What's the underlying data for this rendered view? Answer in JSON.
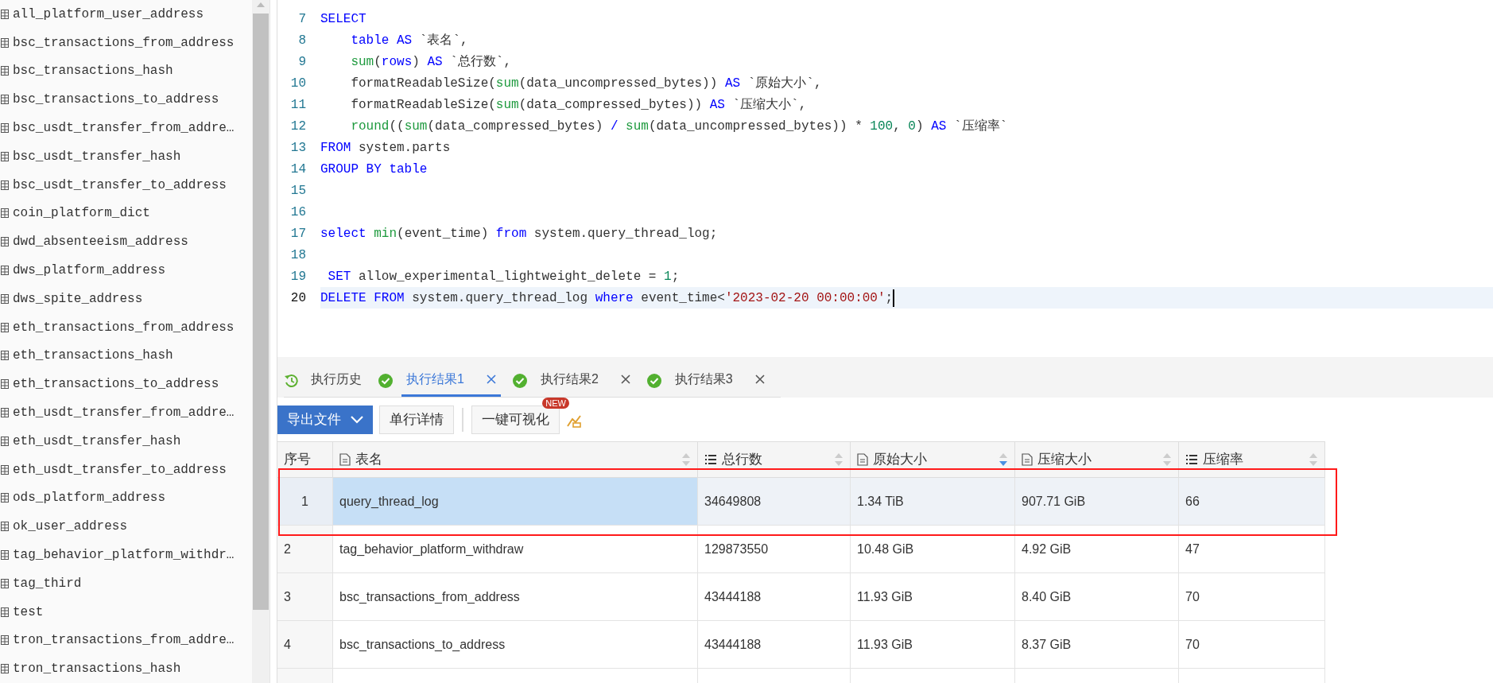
{
  "sidebar": {
    "items": [
      "all_platform_user_address",
      "bsc_transactions_from_address",
      "bsc_transactions_hash",
      "bsc_transactions_to_address",
      "bsc_usdt_transfer_from_addre…",
      "bsc_usdt_transfer_hash",
      "bsc_usdt_transfer_to_address",
      "coin_platform_dict",
      "dwd_absenteeism_address",
      "dws_platform_address",
      "dws_spite_address",
      "eth_transactions_from_address",
      "eth_transactions_hash",
      "eth_transactions_to_address",
      "eth_usdt_transfer_from_addre…",
      "eth_usdt_transfer_hash",
      "eth_usdt_transfer_to_address",
      "ods_platform_address",
      "ok_user_address",
      "tag_behavior_platform_withdr…",
      "tag_third",
      "test",
      "tron_transactions_from_addre…",
      "tron_transactions_hash"
    ]
  },
  "editor": {
    "lines": [
      {
        "number": "7",
        "current": false,
        "tokens": [
          {
            "kind": "keyword",
            "text": "SELECT"
          }
        ]
      },
      {
        "number": "8",
        "current": false,
        "tokens": [
          {
            "kind": "keyword",
            "text": "    table AS"
          },
          {
            "kind": "plain",
            "text": " `表名`,"
          }
        ]
      },
      {
        "number": "9",
        "current": false,
        "tokens": [
          {
            "kind": "function",
            "text": "    sum"
          },
          {
            "kind": "plain",
            "text": "("
          },
          {
            "kind": "keyword",
            "text": "rows"
          },
          {
            "kind": "plain",
            "text": ") "
          },
          {
            "kind": "keyword",
            "text": "AS"
          },
          {
            "kind": "plain",
            "text": " `总行数`,"
          }
        ]
      },
      {
        "number": "10",
        "current": false,
        "tokens": [
          {
            "kind": "plain",
            "text": "    formatReadableSize("
          },
          {
            "kind": "function",
            "text": "sum"
          },
          {
            "kind": "plain",
            "text": "(data_uncompressed_bytes)) "
          },
          {
            "kind": "keyword",
            "text": "AS"
          },
          {
            "kind": "plain",
            "text": " `原始大小`,"
          }
        ]
      },
      {
        "number": "11",
        "current": false,
        "tokens": [
          {
            "kind": "plain",
            "text": "    formatReadableSize("
          },
          {
            "kind": "function",
            "text": "sum"
          },
          {
            "kind": "plain",
            "text": "(data_compressed_bytes)) "
          },
          {
            "kind": "keyword",
            "text": "AS"
          },
          {
            "kind": "plain",
            "text": " `压缩大小`,"
          }
        ]
      },
      {
        "number": "12",
        "current": false,
        "tokens": [
          {
            "kind": "function",
            "text": "    round"
          },
          {
            "kind": "plain",
            "text": "(("
          },
          {
            "kind": "function",
            "text": "sum"
          },
          {
            "kind": "plain",
            "text": "(data_compressed_bytes) "
          },
          {
            "kind": "keyword",
            "text": "/ "
          },
          {
            "kind": "function",
            "text": "sum"
          },
          {
            "kind": "plain",
            "text": "(data_uncompressed_bytes)) * "
          },
          {
            "kind": "number",
            "text": "100"
          },
          {
            "kind": "plain",
            "text": ", "
          },
          {
            "kind": "number",
            "text": "0"
          },
          {
            "kind": "plain",
            "text": ") "
          },
          {
            "kind": "keyword",
            "text": "AS"
          },
          {
            "kind": "plain",
            "text": " `压缩率`"
          }
        ]
      },
      {
        "number": "13",
        "current": false,
        "tokens": [
          {
            "kind": "keyword",
            "text": "FROM"
          },
          {
            "kind": "plain",
            "text": " system.parts"
          }
        ]
      },
      {
        "number": "14",
        "current": false,
        "tokens": [
          {
            "kind": "keyword",
            "text": "GROUP BY table"
          }
        ]
      },
      {
        "number": "15",
        "current": false
      },
      {
        "number": "16",
        "current": false
      },
      {
        "number": "17",
        "current": false,
        "tokens": [
          {
            "kind": "keyword",
            "text": "select "
          },
          {
            "kind": "function",
            "text": "min"
          },
          {
            "kind": "plain",
            "text": "(event_time) "
          },
          {
            "kind": "keyword",
            "text": "from"
          },
          {
            "kind": "plain",
            "text": " system.query_thread_log;"
          }
        ]
      },
      {
        "number": "18",
        "current": false
      },
      {
        "number": "19",
        "current": false,
        "tokens": [
          {
            "kind": "keyword",
            "text": " SET"
          },
          {
            "kind": "plain",
            "text": " allow_experimental_lightweight_delete = "
          },
          {
            "kind": "number",
            "text": "1"
          },
          {
            "kind": "plain",
            "text": ";"
          }
        ]
      },
      {
        "number": "20",
        "current": true,
        "tokens": [
          {
            "kind": "keyword",
            "text": "DELETE FROM"
          },
          {
            "kind": "plain",
            "text": " system.query_thread_log "
          },
          {
            "kind": "keyword",
            "text": "where"
          },
          {
            "kind": "plain",
            "text": " event_time<"
          },
          {
            "kind": "string",
            "text": "'2023-02-20 00:00:00'"
          },
          {
            "kind": "plain",
            "text": ";"
          }
        ]
      }
    ]
  },
  "tabs": [
    {
      "label": "执行历史",
      "kind": "history",
      "selected": false
    },
    {
      "label": "执行结果1",
      "kind": "result",
      "selected": true
    },
    {
      "label": "执行结果2",
      "kind": "result",
      "selected": false
    },
    {
      "label": "执行结果3",
      "kind": "result",
      "selected": false
    }
  ],
  "toolbar": [
    {
      "label": "导出文件",
      "kind": "dropdown"
    },
    {
      "label": "单行详情",
      "kind": "plain"
    },
    {
      "label": "一键可视化",
      "kind": "plain",
      "badge": "NEW"
    }
  ],
  "table": {
    "columns": [
      {
        "label": "序号",
        "kind": "index"
      },
      {
        "label": "表名",
        "kind": "text",
        "sorted_descending": false
      },
      {
        "label": "总行数",
        "kind": "number",
        "sorted_descending": false
      },
      {
        "label": "原始大小",
        "kind": "text",
        "sorted_descending": true
      },
      {
        "label": "压缩大小",
        "kind": "text",
        "sorted_descending": false
      },
      {
        "label": "压缩率",
        "kind": "number",
        "sorted_descending": false
      }
    ],
    "rows": [
      {
        "selected": true,
        "cells": [
          {
            "text": "1",
            "selected": false
          },
          {
            "text": "query_thread_log",
            "selected": true
          },
          {
            "text": "34649808",
            "selected": false
          },
          {
            "text": "1.34 TiB",
            "selected": false
          },
          {
            "text": "907.71 GiB",
            "selected": false
          },
          {
            "text": "66",
            "selected": false
          }
        ]
      },
      {
        "selected": false,
        "cells": [
          {
            "text": "2",
            "selected": false
          },
          {
            "text": "tag_behavior_platform_withdraw",
            "selected": false
          },
          {
            "text": "129873550",
            "selected": false
          },
          {
            "text": "10.48 GiB",
            "selected": false
          },
          {
            "text": "4.92 GiB",
            "selected": false
          },
          {
            "text": "47",
            "selected": false
          }
        ]
      },
      {
        "selected": false,
        "cells": [
          {
            "text": "3",
            "selected": false
          },
          {
            "text": "bsc_transactions_from_address",
            "selected": false
          },
          {
            "text": "43444188",
            "selected": false
          },
          {
            "text": "11.93 GiB",
            "selected": false
          },
          {
            "text": "8.40 GiB",
            "selected": false
          },
          {
            "text": "70",
            "selected": false
          }
        ]
      },
      {
        "selected": false,
        "cells": [
          {
            "text": "4",
            "selected": false
          },
          {
            "text": "bsc_transactions_to_address",
            "selected": false
          },
          {
            "text": "43444188",
            "selected": false
          },
          {
            "text": "11.93 GiB",
            "selected": false
          },
          {
            "text": "8.37 GiB",
            "selected": false
          },
          {
            "text": "70",
            "selected": false
          }
        ]
      }
    ]
  }
}
